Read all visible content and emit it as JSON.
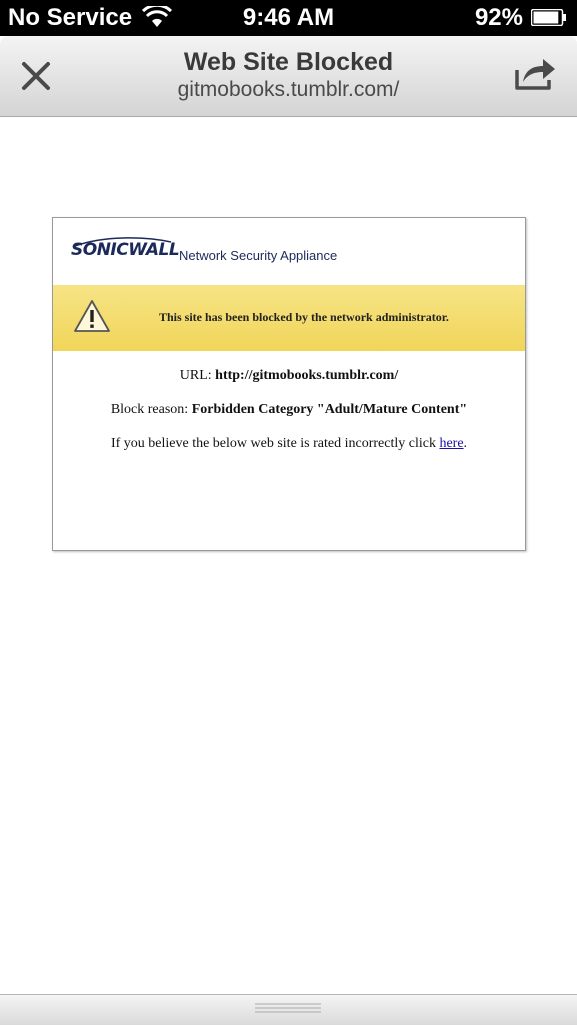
{
  "status_bar": {
    "carrier": "No Service",
    "time": "9:46 AM",
    "battery_percent": "92%",
    "battery_level": 0.92,
    "wifi_icon": "wifi-icon",
    "battery_icon": "battery-icon"
  },
  "nav_bar": {
    "title": "Web Site Blocked",
    "subtitle": "gitmobooks.tumblr.com/",
    "close_icon": "close-icon",
    "share_icon": "share-icon"
  },
  "block_page": {
    "logo_text": "SONICWALL",
    "logo_tagline": "Network Security Appliance",
    "alert_icon": "warning-icon",
    "alert_text": "This site has been blocked by the network administrator.",
    "url_label": "URL:",
    "url_value": "http://gitmobooks.tumblr.com/",
    "reason_label": "Block reason:",
    "reason_value": "Forbidden Category \"Adult/Mature Content\"",
    "rated_text": "If you believe the below web site is rated incorrectly click",
    "rated_link": "here",
    "rated_suffix": "."
  },
  "bottom_bar": {
    "grip_icon": "drag-handle-icon"
  },
  "colors": {
    "alert_band": "#f1d55a",
    "logo": "#1b2a5a",
    "link": "#1a0dab"
  }
}
